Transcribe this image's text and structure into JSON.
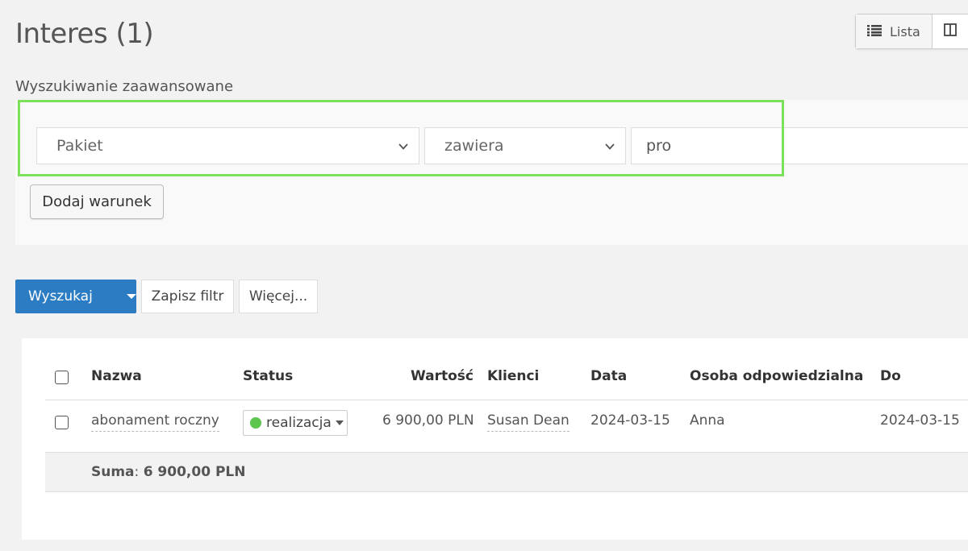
{
  "page": {
    "title": "Interes (1)"
  },
  "view_switch": {
    "list_label": "Lista"
  },
  "advanced_search": {
    "label": "Wyszukiwanie zaawansowane",
    "field_select": "Pakiet",
    "operator_select": "zawiera",
    "value": "pro",
    "add_condition_label": "Dodaj warunek"
  },
  "actions": {
    "search_label": "Wyszukaj",
    "save_filter_label": "Zapisz filtr",
    "more_label": "Więcej..."
  },
  "table": {
    "headers": {
      "name": "Nazwa",
      "status": "Status",
      "value": "Wartość",
      "clients": "Klienci",
      "date": "Data",
      "owner": "Osoba odpowiedzialna",
      "to": "Do"
    },
    "rows": [
      {
        "name": "abonament roczny",
        "status": "realizacja",
        "status_color": "#5cc64e",
        "value": "6 900,00 PLN",
        "clients": "Susan Dean",
        "date": "2024-03-15",
        "owner": "Anna",
        "to": "2024-03-15"
      }
    ],
    "sum_label": "Suma",
    "sum_value": "6 900,00 PLN"
  },
  "colors": {
    "primary": "#2b7cc2",
    "highlight": "#7de05a"
  }
}
